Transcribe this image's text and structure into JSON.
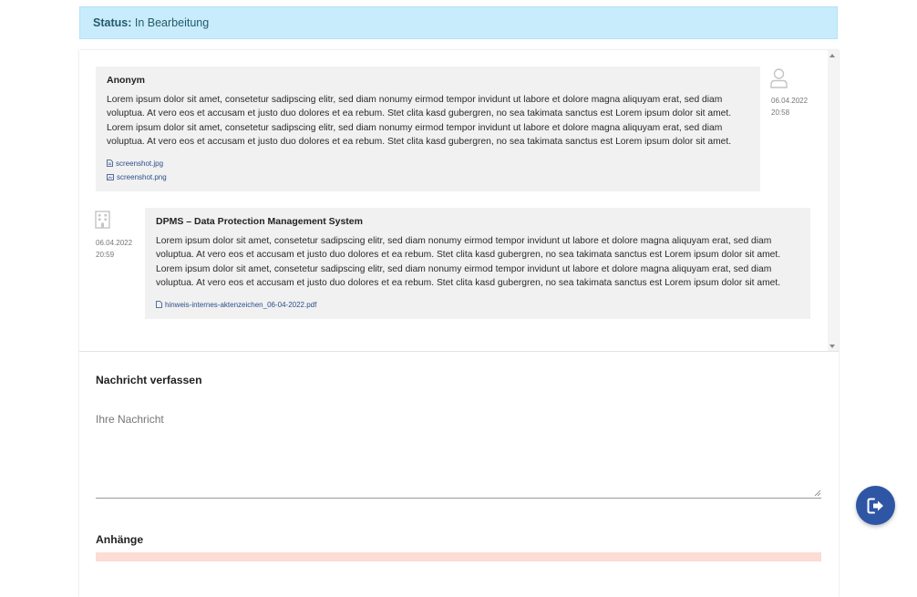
{
  "status": {
    "label": "Status:",
    "value": "In Bearbeitung"
  },
  "thread": {
    "messages": [
      {
        "sender": "Anonym",
        "date": "06.04.2022",
        "time": "20:58",
        "text": "Lorem ipsum dolor sit amet, consetetur sadipscing elitr, sed diam nonumy eirmod tempor invidunt ut labore et dolore magna aliquyam erat, sed diam voluptua. At vero eos et accusam et justo duo dolores et ea rebum. Stet clita kasd gubergren, no sea takimata sanctus est Lorem ipsum dolor sit amet. Lorem ipsum dolor sit amet, consetetur sadipscing elitr, sed diam nonumy eirmod tempor invidunt ut labore et dolore magna aliquyam erat, sed diam voluptua. At vero eos et accusam et justo duo dolores et ea rebum. Stet clita kasd gubergren, no sea takimata sanctus est Lorem ipsum dolor sit amet.",
        "attachments": [
          {
            "name": "screenshot.jpg",
            "icon": "file-icon"
          },
          {
            "name": "screenshot.png",
            "icon": "image-icon"
          }
        ]
      },
      {
        "sender": "DPMS – Data Protection Management System",
        "date": "06.04.2022",
        "time": "20:59",
        "text": "Lorem ipsum dolor sit amet, consetetur sadipscing elitr, sed diam nonumy eirmod tempor invidunt ut labore et dolore magna aliquyam erat, sed diam voluptua. At vero eos et accusam et justo duo dolores et ea rebum. Stet clita kasd gubergren, no sea takimata sanctus est Lorem ipsum dolor sit amet. Lorem ipsum dolor sit amet, consetetur sadipscing elitr, sed diam nonumy eirmod tempor invidunt ut labore et dolore magna aliquyam erat, sed diam voluptua. At vero eos et accusam et justo duo dolores et ea rebum. Stet clita kasd gubergren, no sea takimata sanctus est Lorem ipsum dolor sit amet.",
        "attachments": [
          {
            "name": "hinweis-internes-aktenzeichen_06-04-2022.pdf",
            "icon": "file-icon"
          }
        ]
      }
    ]
  },
  "compose": {
    "title": "Nachricht verfassen",
    "placeholder": "Ihre Nachricht",
    "value": ""
  },
  "attachments_section": {
    "title": "Anhänge"
  },
  "colors": {
    "status_bg": "#c8ecfb",
    "bubble_bg": "#f1f1f1",
    "link": "#2b4f8c",
    "fab": "#2f56a4",
    "alert": "#fddcd4"
  },
  "icons": {
    "avatar_user": "user-avatar-icon",
    "avatar_org": "building-icon",
    "fab": "logout-icon"
  }
}
